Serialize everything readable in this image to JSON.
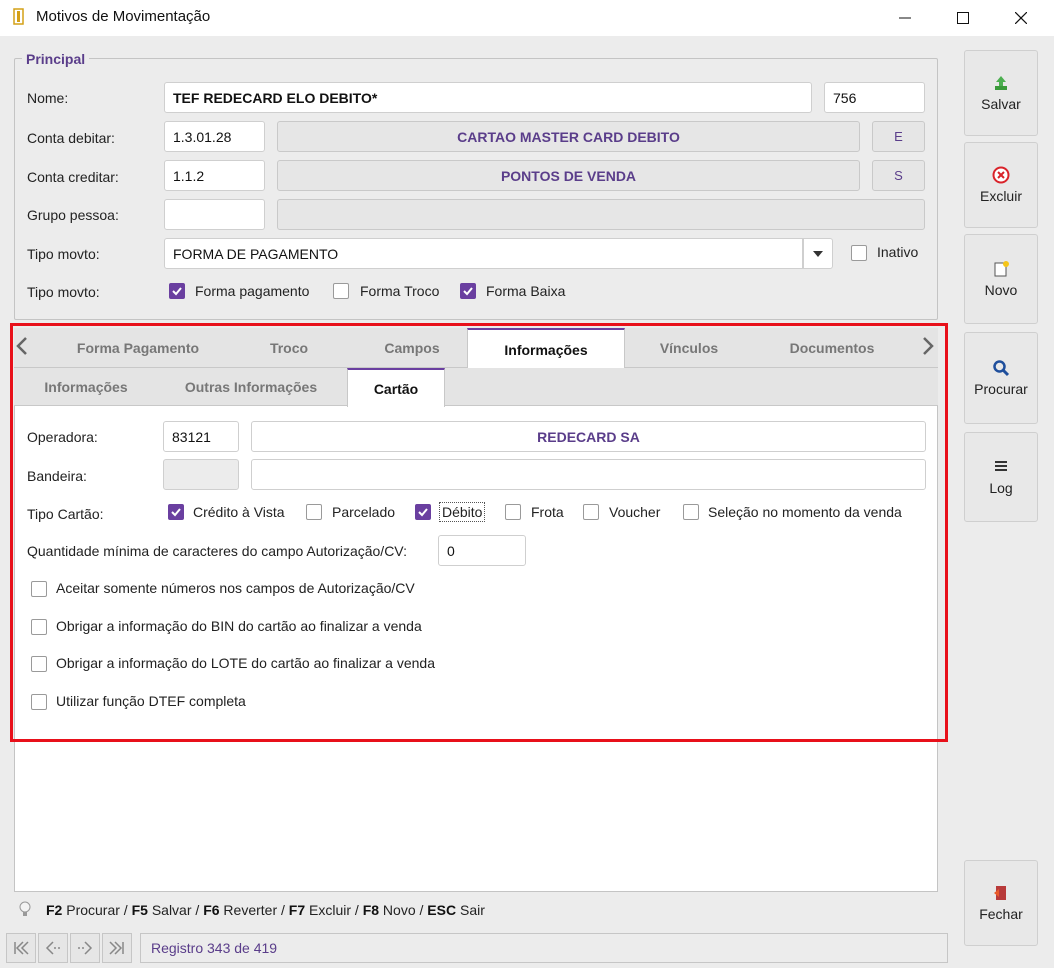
{
  "window": {
    "title": "Motivos de Movimentação"
  },
  "principal": {
    "legend": "Principal",
    "nome_label": "Nome:",
    "nome_value": "TEF REDECARD ELO DEBITO*",
    "codigo_value": "756",
    "conta_debitar_label": "Conta debitar:",
    "conta_debitar_code": "1.3.01.28",
    "conta_debitar_desc": "CARTAO MASTER CARD DEBITO",
    "conta_debitar_flag": "E",
    "conta_creditar_label": "Conta creditar:",
    "conta_creditar_code": "1.1.2",
    "conta_creditar_desc": "PONTOS DE VENDA",
    "conta_creditar_flag": "S",
    "grupo_pessoa_label": "Grupo pessoa:",
    "grupo_pessoa_code": "",
    "grupo_pessoa_desc": "",
    "tipo_movto_label": "Tipo movto:",
    "tipo_movto_value": "FORMA DE PAGAMENTO",
    "inativo_label": "Inativo",
    "tipo_movto2_label": "Tipo movto:",
    "forma_pagamento_label": "Forma pagamento",
    "forma_troco_label": "Forma Troco",
    "forma_baixa_label": "Forma Baixa"
  },
  "tabs": {
    "main": [
      "Forma Pagamento",
      "Troco",
      "Campos",
      "Informações",
      "Vínculos",
      "Documentos"
    ],
    "sub": [
      "Informações",
      "Outras Informações",
      "Cartão"
    ]
  },
  "cartao": {
    "operadora_label": "Operadora:",
    "operadora_code": "83121",
    "operadora_desc": "REDECARD SA",
    "bandeira_label": "Bandeira:",
    "bandeira_code": "",
    "bandeira_desc": "",
    "tipo_cartao_label": "Tipo Cartão:",
    "credito_vista": "Crédito à Vista",
    "parcelado": "Parcelado",
    "debito": "Débito",
    "frota": "Frota",
    "voucher": "Voucher",
    "selecao_momento": "Seleção no momento da venda",
    "qtd_min_label": "Quantidade mínima de caracteres do campo Autorização/CV:",
    "qtd_min_value": "0",
    "aceitar_numeros": "Aceitar somente números nos campos de Autorização/CV",
    "obrigar_bin": "Obrigar a informação do BIN do cartão ao finalizar a venda",
    "obrigar_lote": "Obrigar a informação do LOTE do cartão ao finalizar a venda",
    "utilizar_dtef": "Utilizar função DTEF completa"
  },
  "sidebar": {
    "salvar": "Salvar",
    "excluir": "Excluir",
    "novo": "Novo",
    "procurar": "Procurar",
    "log": "Log",
    "fechar": "Fechar"
  },
  "footer": {
    "f2": "F2",
    "f2_text": " Procurar / ",
    "f5": "F5",
    "f5_text": " Salvar / ",
    "f6": "F6",
    "f6_text": " Reverter / ",
    "f7": "F7",
    "f7_text": " Excluir / ",
    "f8": "F8",
    "f8_text": " Novo / ",
    "esc": "ESC",
    "esc_text": " Sair",
    "registro": "Registro 343 de 419"
  },
  "colors": {
    "accent": "#6a3fa0",
    "highlight": "#e8101a"
  }
}
